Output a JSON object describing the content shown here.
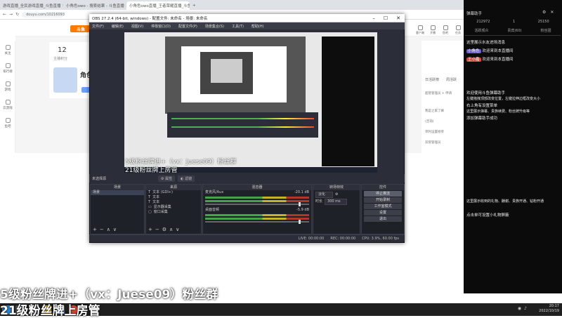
{
  "browser": {
    "tabs": [
      {
        "label": "游戏直播_全民游戏直播_斗鱼直播",
        "active": false
      },
      {
        "label": "小角色owo - 搜索结果 - 斗鱼直播",
        "active": false
      },
      {
        "label": "小角色owo直播_王者荣耀直播_斗鱼",
        "active": true
      }
    ],
    "url": "douyu.com/10216093"
  },
  "sidebar": {
    "items": [
      {
        "label": "关注"
      },
      {
        "label": "排行榜"
      },
      {
        "label": "游戏"
      },
      {
        "label": "云游戏"
      },
      {
        "label": "鱼吧"
      }
    ]
  },
  "page": {
    "logo": "斗鱼",
    "fans_count": "12",
    "fans_label": "主播积分",
    "anchor_name": "角色",
    "top_icons": [
      {
        "label": "客户端"
      },
      {
        "label": "开播"
      },
      {
        "label": "鱼吧"
      },
      {
        "label": "任务"
      },
      {
        "label": "历史"
      },
      {
        "label": "关注"
      }
    ],
    "rank_tabs": [
      "日活跃榜",
      "周活跃"
    ],
    "right_lines": [
      "超管管理员 + 申请",
      "我是之家了嘛",
      "(咨询)",
      "单利设置榜单",
      "双管管理员"
    ]
  },
  "obs": {
    "title": "OBS 27.2.4 (64-bit, windows) - 配置文件: 未命名 - 场景: 未命名",
    "menu": [
      "文件(F)",
      "编辑(E)",
      "视图(V)",
      "停靠窗口(D)",
      "配置文件(P)",
      "场景集合(S)",
      "工具(T)",
      "帮助(H)"
    ],
    "preview_text_1": "5级粉丝牌进+（vx：Juese09）粉丝群",
    "preview_text_2": "21级粉丝牌上房管",
    "source_bar": {
      "scene_label": "未选择源",
      "props_label": "属性",
      "filters_label": "滤镜"
    },
    "docks": {
      "scenes": {
        "title": "场景",
        "items": [
          "场景"
        ]
      },
      "sources": {
        "title": "来源",
        "items": [
          "文本 (GDI+)",
          "文本",
          "文本",
          "显示器采集",
          "窗口采集"
        ]
      },
      "mixer": {
        "title": "混音器",
        "channels": [
          {
            "name": "麦克风/Aux",
            "db": "-20.1 dB"
          },
          {
            "name": "桌面音频",
            "db": "-5.9 dB"
          }
        ]
      },
      "transitions": {
        "title": "转场特效",
        "type": "淡化",
        "duration_label": "时长",
        "duration": "300 ms"
      },
      "controls": {
        "title": "控件",
        "buttons": [
          "停止推流",
          "开始录制",
          "工作室模式",
          "设置",
          "退出"
        ]
      }
    },
    "status": {
      "live": "LIVE: 00:00:00",
      "rec": "REC: 00:00:00",
      "cpu": "CPU: 3.9%, 60.00 fps"
    }
  },
  "chat": {
    "header": "弹幕助手",
    "stats": [
      "212972",
      "1",
      "25150"
    ],
    "tabs": [
      "活跃观众",
      "贵宾(60)",
      "粉丝团"
    ],
    "messages": [
      {
        "text": "这里展示水友进场消息",
        "color": "#ffffff"
      },
      {
        "tag": "小角色",
        "text": "欢迎来到本直播间",
        "tagcolor": "#6b5cd6"
      },
      {
        "tag": "王小嘉",
        "text": "欢迎来到本直播间",
        "tagcolor": "#d24b3b"
      },
      {
        "text": "欢迎使用斗鱼弹幕助手"
      },
      {
        "text": "左键拖拽顶部改变位置，左键拉伸边框改变大小"
      },
      {
        "text": "右上角有设置菜单"
      },
      {
        "text": "这里展示弹幕、贵族续费、粉丝牌升级等"
      },
      {
        "text": "添加弹幕助手成功"
      },
      {
        "text": "这里展示收到的礼物、酬谢、贵族开通、钻粉开通"
      },
      {
        "text": "点击单可设置小礼物屏蔽"
      }
    ]
  },
  "overlay": {
    "line1": "5级粉丝牌进+（vx：Juese09）粉丝群",
    "line2": "21级粉丝牌上房管"
  },
  "taskbar": {
    "time": "20:17",
    "date": "2022/10/19"
  }
}
